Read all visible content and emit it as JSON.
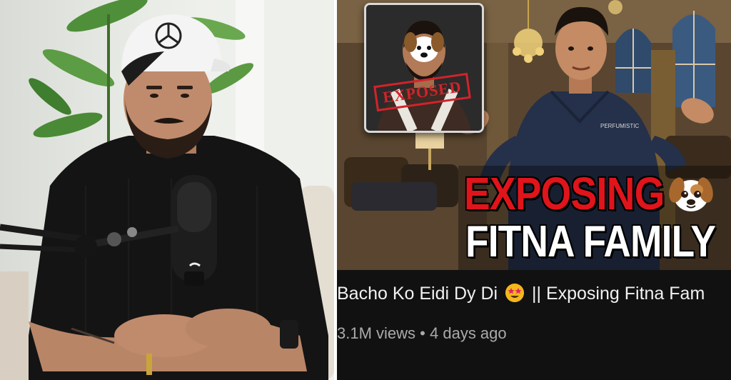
{
  "thumbnail": {
    "headline_line1": "EXPOSING",
    "headline_line2": "FITNA FAMILY",
    "inset_stamp": "EXPOSED",
    "shirt_logo": "PERFUMISTIC",
    "accent_red": "#e0141b"
  },
  "video": {
    "title_part1": "Bacho Ko Eidi Dy Di",
    "title_emoji": "star-struck-emoji",
    "title_part2": "|| Exposing Fitna Fam",
    "views": "3.1M views",
    "separator": "•",
    "age": "4 days ago"
  },
  "colors": {
    "card_background": "#111111",
    "title_text": "#f1f1f1",
    "meta_text": "#aaaaaa"
  }
}
